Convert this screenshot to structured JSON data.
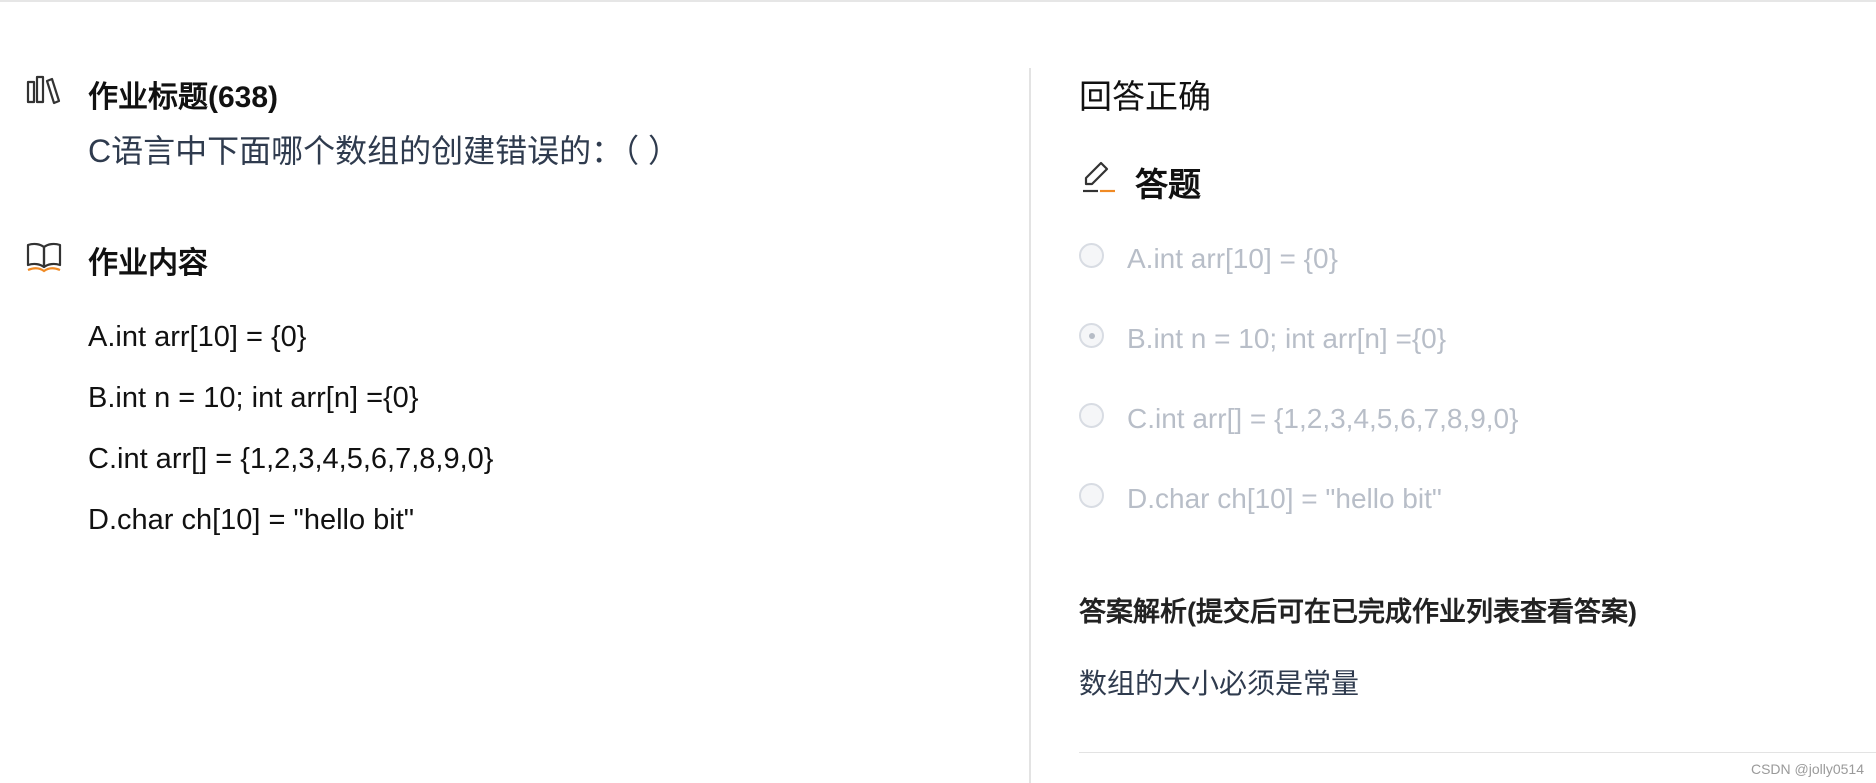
{
  "homework": {
    "title_label": "作业标题(638)",
    "question": "C语言中下面哪个数组的创建错误的：（ ）",
    "content_label": "作业内容",
    "options": [
      "A.int arr[10] = {0}",
      "B.int n = 10; int arr[n] ={0}",
      "C.int arr[] = {1,2,3,4,5,6,7,8,9,0}",
      "D.char ch[10] = \"hello bit\""
    ]
  },
  "answer_panel": {
    "result": "回答正确",
    "answer_heading": "答题",
    "choices": [
      {
        "label": "A.int arr[10] = {0}",
        "selected": false
      },
      {
        "label": "B.int n = 10; int arr[n] ={0}",
        "selected": true
      },
      {
        "label": "C.int arr[] = {1,2,3,4,5,6,7,8,9,0}",
        "selected": false
      },
      {
        "label": "D.char ch[10] = \"hello bit\"",
        "selected": false
      }
    ],
    "analysis_heading": "答案解析(提交后可在已完成作业列表查看答案)",
    "analysis_text": "数组的大小必须是常量"
  },
  "watermark": "CSDN @jolly0514",
  "icons": {
    "title": "books-icon",
    "content": "open-book-icon",
    "answer": "edit-pen-icon"
  },
  "colors": {
    "accent": "#f08a24",
    "question_text": "#2f3b4e",
    "disabled_text": "#b8bec8"
  }
}
